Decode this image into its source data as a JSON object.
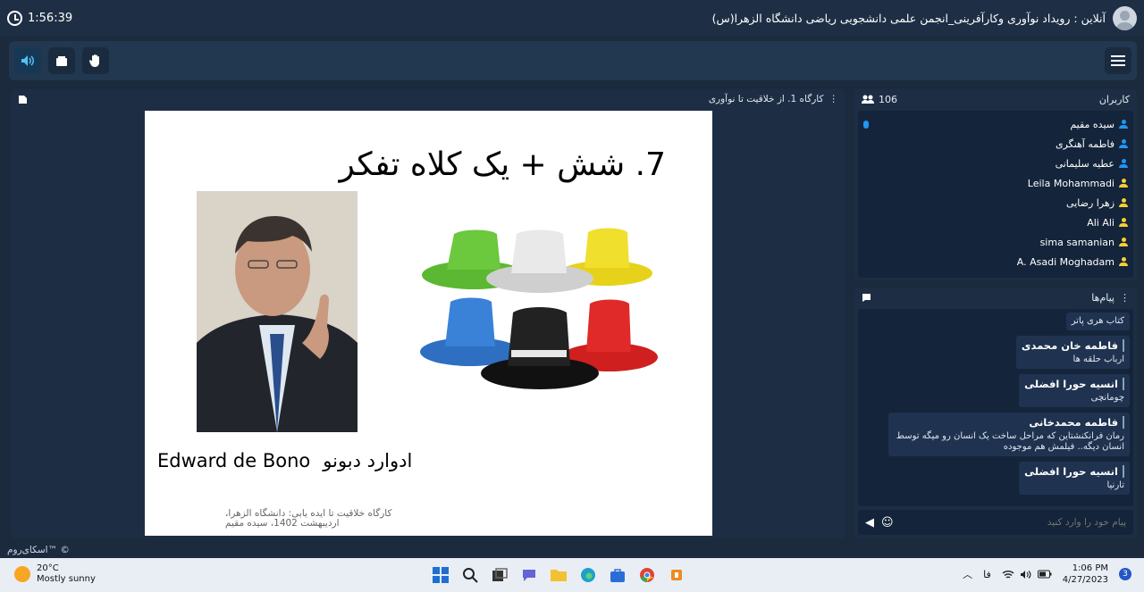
{
  "topbar": {
    "timer": "1:56:39",
    "room_title": "آنلاین : رویداد نوآوری وکارآفرینی_انجمن علمی دانشجویی ریاضی دانشگاه الزهرا(س)"
  },
  "toolbar": {
    "buttons": [
      "speaker-icon",
      "screen-share-icon",
      "raise-hand-icon"
    ],
    "menu": "menu-icon"
  },
  "stage": {
    "title": "کارگاه 1. از خلاقیت تا نوآوری",
    "slide": {
      "title": "7. شش + یک کلاه تفکر",
      "name_en": "Edward de Bono",
      "name_fa": "ادوارد دبونو",
      "footer_line1": "کارگاه خلاقیت تا ایده یابی: دانشگاه الزهرا،",
      "footer_line2": "اردیبهشت 1402، سیده مقیم"
    }
  },
  "watermark": "اسکای‌روم™ ©",
  "users_panel": {
    "title": "کاربران",
    "count": "106",
    "users": [
      {
        "name": "سیده مقیم",
        "color": "#2196f3",
        "mic": true
      },
      {
        "name": "فاطمه آهنگری",
        "color": "#2196f3",
        "mic": false
      },
      {
        "name": "عطیه سلیمانی",
        "color": "#2196f3",
        "mic": false
      },
      {
        "name": "Leila Mohammadi",
        "color": "#f5d033",
        "mic": false
      },
      {
        "name": "زهرا رضایی",
        "color": "#f5d033",
        "mic": false
      },
      {
        "name": "Ali Ali",
        "color": "#f5d033",
        "mic": false
      },
      {
        "name": "sima samanian",
        "color": "#f5d033",
        "mic": false
      },
      {
        "name": "A. Asadi Moghadam",
        "color": "#f5d033",
        "mic": false
      }
    ]
  },
  "chat_panel": {
    "title": "پیام‌ها",
    "messages": [
      {
        "name": "",
        "text": "کتاب هری پاتر"
      },
      {
        "name": "فاطمه خان محمدی",
        "text": "ارباب حلقه ها"
      },
      {
        "name": "انسیه حورا افضلی",
        "text": "چومانچی"
      },
      {
        "name": "فاطمه محمدخانی",
        "text": "رمان فرانکنشتاین که مراحل ساخت یک انسان رو میگه توسط انسان دیگه.. فیلمش هم موجوده"
      },
      {
        "name": "انسیه حورا افضلی",
        "text": "تارنیا"
      }
    ],
    "input_placeholder": "پیام خود را وارد کنید"
  },
  "taskbar": {
    "temperature": "20°C",
    "weather": "Mostly sunny",
    "language": "فا",
    "time": "1:06 PM",
    "date": "4/27/2023",
    "notifications": "3"
  }
}
